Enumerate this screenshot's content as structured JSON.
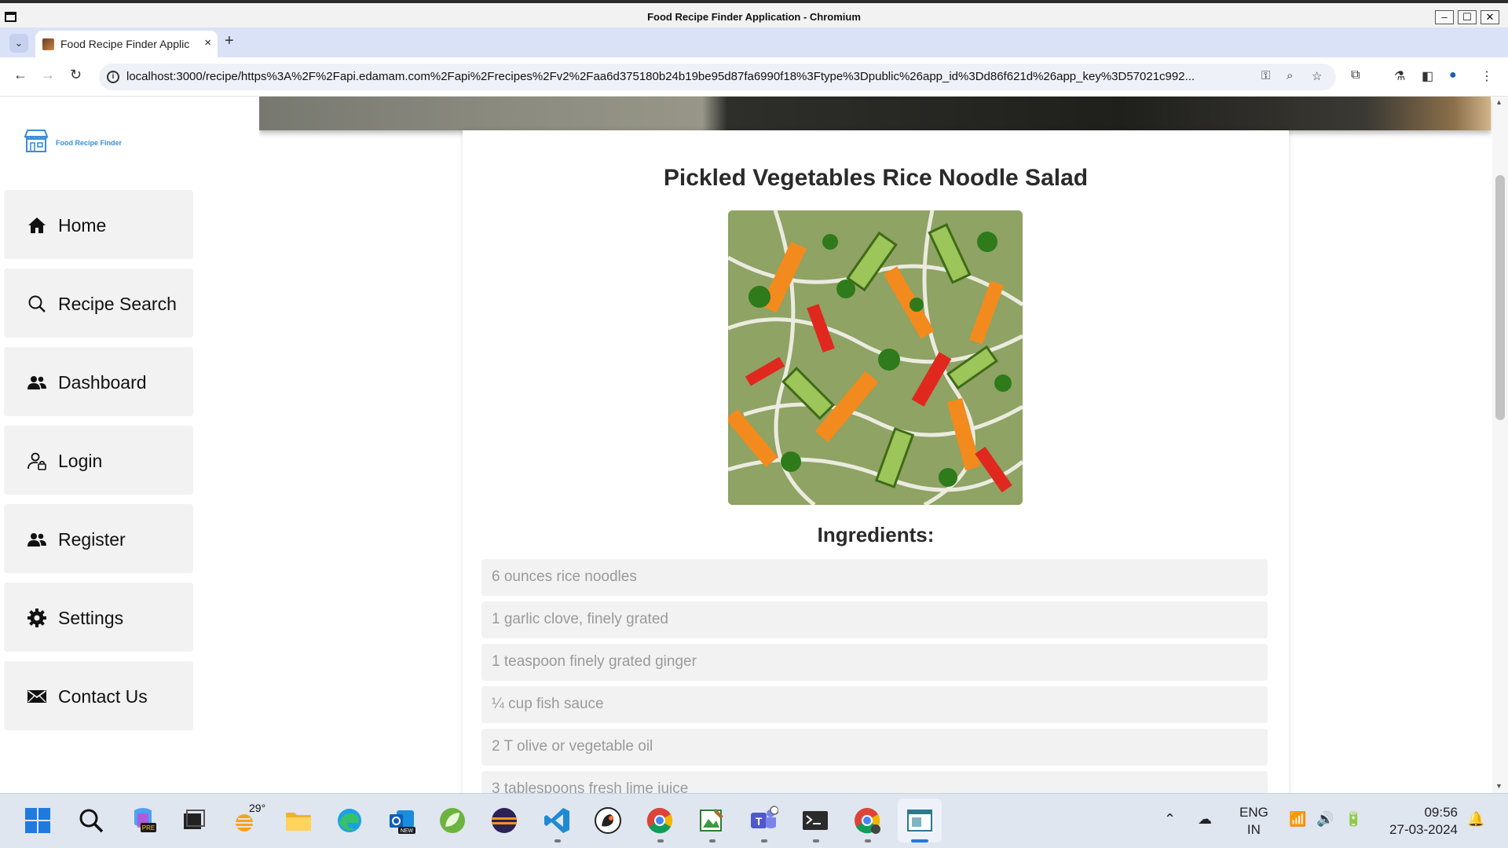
{
  "window": {
    "title": "Food Recipe Finder Application - Chromium",
    "minimize": "–",
    "maximize": "☐",
    "close": "✕"
  },
  "browser": {
    "tab_title": "Food Recipe Finder Applic",
    "tab_close": "×",
    "new_tab": "+",
    "url": "localhost:3000/recipe/https%3A%2F%2Fapi.edamam.com%2Fapi%2Frecipes%2Fv2%2Faa6d375180b24b19be95d87fa6990f18%3Ftype%3Dpublic%26app_id%3Dd86f621d%26app_key%3D57021c992..."
  },
  "app": {
    "logo_text": "Food Recipe Finder",
    "nav": [
      {
        "label": "Home",
        "icon": "home-icon"
      },
      {
        "label": "Recipe Search",
        "icon": "search-icon"
      },
      {
        "label": "Dashboard",
        "icon": "users-icon"
      },
      {
        "label": "Login",
        "icon": "user-lock-icon"
      },
      {
        "label": "Register",
        "icon": "users-icon"
      },
      {
        "label": "Settings",
        "icon": "gear-icon"
      },
      {
        "label": "Contact Us",
        "icon": "envelope-icon"
      }
    ]
  },
  "recipe": {
    "title": "Pickled Vegetables Rice Noodle Salad",
    "image_alt": "Rice noodle salad with pickled carrots, cucumber, peppers and herbs",
    "ingredients_heading": "Ingredients:",
    "ingredients": [
      "6 ounces rice noodles",
      "1 garlic clove, finely grated",
      "1 teaspoon finely grated ginger",
      "¼ cup fish sauce",
      "2 T olive or vegetable oil",
      "3 tablespoons fresh lime juice"
    ]
  },
  "taskbar": {
    "weather_temp": "29°",
    "lang_line1": "ENG",
    "lang_line2": "IN",
    "time": "09:56",
    "date": "27-03-2024"
  },
  "colors": {
    "accent": "#3a8dd6",
    "nav_bg": "#f2f2f2",
    "ingredient_bg": "#f2f2f2",
    "ingredient_text": "#9a9a9a",
    "tabstrip_bg": "#dae2f8"
  }
}
